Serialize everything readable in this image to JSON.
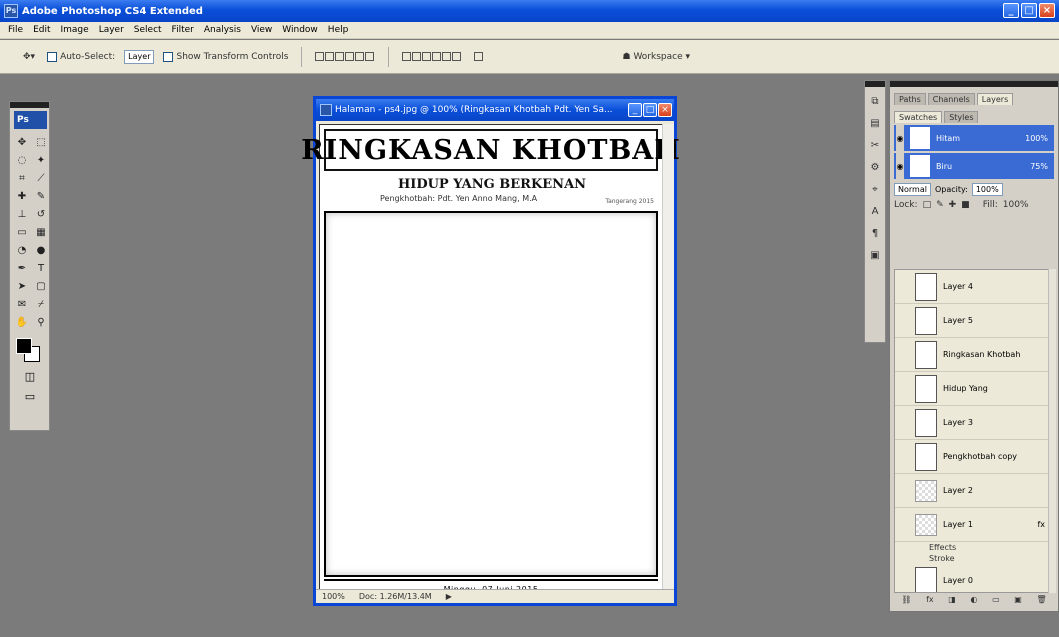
{
  "app": {
    "title": "Adobe Photoshop CS4 Extended",
    "window_controls": [
      "_",
      "□",
      "×"
    ]
  },
  "menu": [
    "File",
    "Edit",
    "Image",
    "Layer",
    "Select",
    "Filter",
    "Analysis",
    "View",
    "Window",
    "Help"
  ],
  "options": {
    "tool_icon": "move-tool-icon",
    "auto_select_label": "Auto-Select:",
    "auto_select_value": "Layer",
    "show_transform_label": "Show Transform Controls",
    "workspace_label": "Workspace"
  },
  "toolbox": {
    "badge": "Ps",
    "tools": [
      "move",
      "marquee",
      "lasso",
      "magic-wand",
      "crop",
      "slice",
      "healing",
      "brush",
      "clone",
      "history",
      "eraser",
      "gradient",
      "blur",
      "dodge",
      "pen",
      "type",
      "path-select",
      "shape",
      "notes",
      "eyedropper",
      "hand",
      "zoom"
    ]
  },
  "document": {
    "title": "Halaman - ps4.jpg @ 100% (Ringkasan Khotbah Pdt. Yen Sa...",
    "banner": "RINGKASAN KHOTBAH",
    "subtitle": "HIDUP YANG BERKENAN",
    "preacher": "Pengkhotbah: Pdt. Yen Anno Mang, M.A",
    "preacher_note": "Tangerang 2015",
    "date": "Minggu, 07 Juni 2015",
    "zoom": "100%",
    "doc_size": "Doc: 1.26M/13.4M"
  },
  "minibar_icons": [
    "history-icon",
    "actions-icon",
    "tools-icon",
    "adjust-icon",
    "navigator-icon",
    "character-icon",
    "paragraph-icon",
    "layer-comps-icon"
  ],
  "layers_panel": {
    "tabs_top": [
      "Paths",
      "Channels",
      "Layers"
    ],
    "tabs_mid": [
      "Swatches",
      "Styles"
    ],
    "swatches": [
      {
        "label": "Hitam",
        "value": "100%"
      },
      {
        "label": "Biru",
        "value": "75%"
      }
    ],
    "blend_mode": "Normal",
    "opacity_label": "Opacity:",
    "opacity_value": "100%",
    "lock_label": "Lock:",
    "fill_label": "Fill:",
    "fill_value": "100%",
    "layers": [
      {
        "name": "Layer 4",
        "kind": "layer"
      },
      {
        "name": "Layer 5",
        "kind": "layer"
      },
      {
        "name": "Ringkasan Khotbah",
        "kind": "layer"
      },
      {
        "name": "Hidup Yang",
        "kind": "layer"
      },
      {
        "name": "Layer 3",
        "kind": "layer"
      },
      {
        "name": "Pengkhotbah copy",
        "kind": "layer"
      },
      {
        "name": "Layer 2",
        "kind": "group"
      },
      {
        "name": "Layer 1",
        "kind": "group"
      }
    ],
    "effects": [
      "Effects",
      "Stroke"
    ],
    "last_layer": "Layer 0"
  }
}
